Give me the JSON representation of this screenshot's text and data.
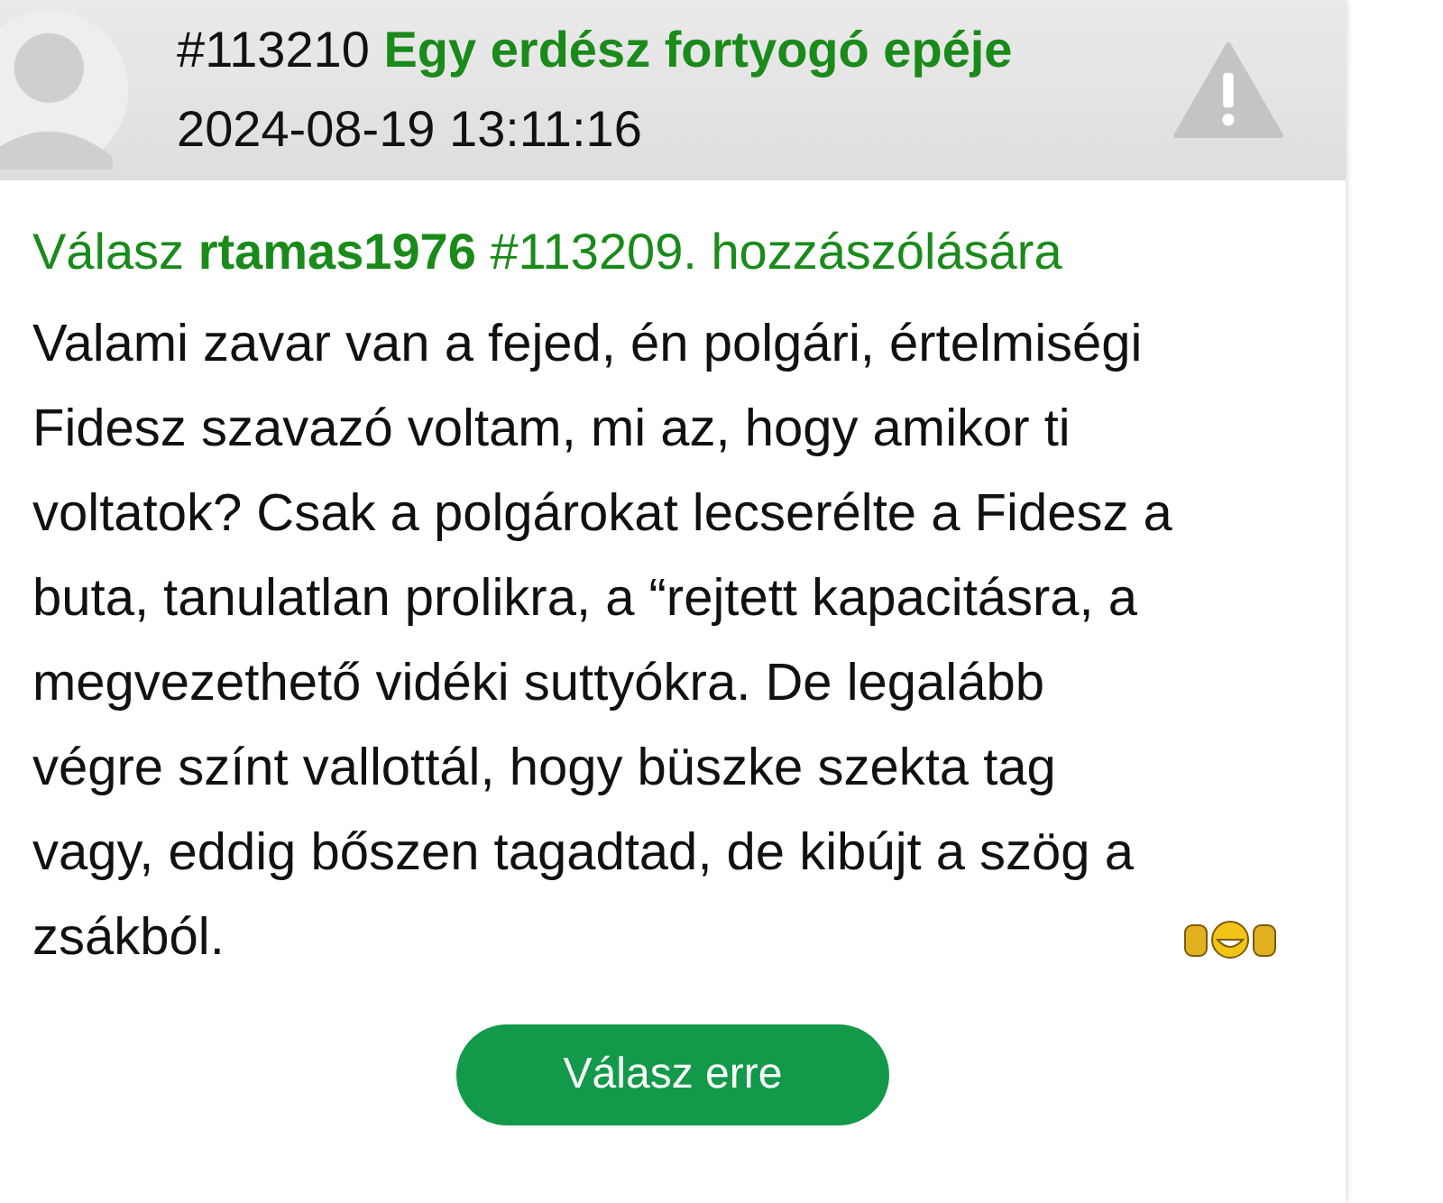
{
  "post": {
    "number": "#113210",
    "author": "Egy erdész fortyogó epéje",
    "timestamp": "2024-08-19 13:11:16"
  },
  "reply_to": "Válasz **rtamas1976** #113209. hozzászólására",
  "body": "Valami zavar van a fejed, én polgári, értelmiségi Fidesz szavazó voltam, mi az, hogy amikor ti voltatok? Csak a polgárokat lecserélte a Fidesz a buta, tanulatlan prolikra, a “rejtett kapacitásra, a megvezethető vidéki suttyókra. De legalább végre színt vallottál, hogy büszke szekta tag vagy, eddig bőszen tagadtad, de kibújt a szög a zsákból.",
  "reply_button": "Válasz erre"
}
